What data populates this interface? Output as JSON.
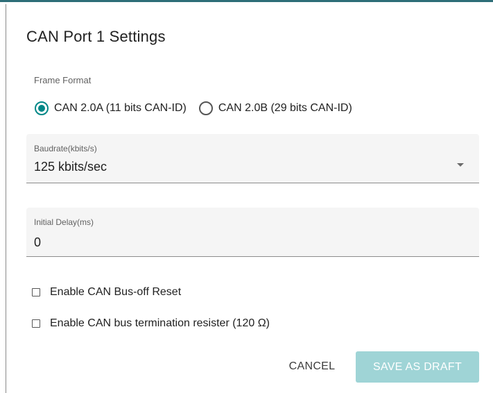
{
  "dialog": {
    "title": "CAN Port 1 Settings"
  },
  "frame_format": {
    "label": "Frame Format",
    "options": [
      {
        "label": "CAN 2.0A (11 bits CAN-ID)",
        "selected": true
      },
      {
        "label": "CAN 2.0B (29 bits CAN-ID)",
        "selected": false
      }
    ]
  },
  "baudrate": {
    "label": "Baudrate(kbits/s)",
    "value": "125 kbits/sec"
  },
  "initial_delay": {
    "label": "Initial Delay(ms)",
    "value": "0"
  },
  "checkboxes": [
    {
      "label": "Enable CAN Bus-off Reset",
      "checked": false
    },
    {
      "label": "Enable CAN bus termination resister (120 Ω)",
      "checked": false
    }
  ],
  "actions": {
    "cancel_label": "CANCEL",
    "save_label": "SAVE AS DRAFT"
  },
  "colors": {
    "accent": "#008787",
    "primary_button_disabled": "#9fd4d6",
    "field_background": "#f5f5f5"
  },
  "icons": {
    "dropdown": "chevron-down-icon",
    "radio_selected": "radio-checked-icon",
    "radio_unselected": "radio-unchecked-icon",
    "checkbox": "checkbox-unchecked-icon"
  }
}
